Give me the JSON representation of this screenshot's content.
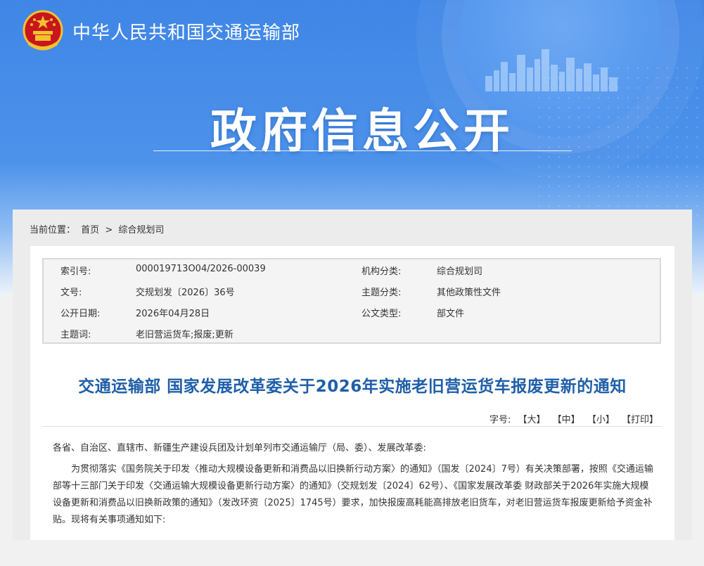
{
  "header": {
    "ministry_name": "中华人民共和国交通运输部",
    "section_title": "政府信息公开"
  },
  "breadcrumb": {
    "label": "当前位置：",
    "home": "首页",
    "separator": ">",
    "current": "综合规划司"
  },
  "meta": {
    "index_label": "索引号:",
    "index_value": "000019713O04/2026-00039",
    "org_label": "机构分类:",
    "org_value": "综合规划司",
    "doc_no_label": "文号:",
    "doc_no_value": "交规划发〔2026〕36号",
    "topic_label": "主题分类:",
    "topic_value": "其他政策性文件",
    "date_label": "公开日期:",
    "date_value": "2026年04月28日",
    "type_label": "公文类型:",
    "type_value": "部文件",
    "keywords_label": "主题词:",
    "keywords_value": "老旧营运货车;报废;更新"
  },
  "article": {
    "title": "交通运输部 国家发展改革委关于2026年实施老旧营运货车报废更新的通知",
    "font_label": "字号:",
    "font_large": "【大】",
    "font_medium": "【中】",
    "font_small": "【小】",
    "print": "【打印】",
    "salutation": "各省、自治区、直辖市、新疆生产建设兵团及计划单列市交通运输厅（局、委）、发展改革委:",
    "paragraph1": "为贯彻落实《国务院关于印发〈推动大规模设备更新和消费品以旧换新行动方案〉的通知》（国发〔2024〕7号）有关决策部署，按照《交通运输部等十三部门关于印发〈交通运输大规模设备更新行动方案〉的通知》（交规划发〔2024〕62号）、《国家发展改革委 财政部关于2026年实施大规模设备更新和消费品以旧换新政策的通知》（发改环资〔2025〕1745号）要求，加快报废高耗能高排放老旧货车，对老旧营运货车报废更新给予资金补贴。现将有关事项通知如下:"
  },
  "colors": {
    "header_blue": "#3f86e6",
    "title_blue": "#1f5fa8"
  }
}
